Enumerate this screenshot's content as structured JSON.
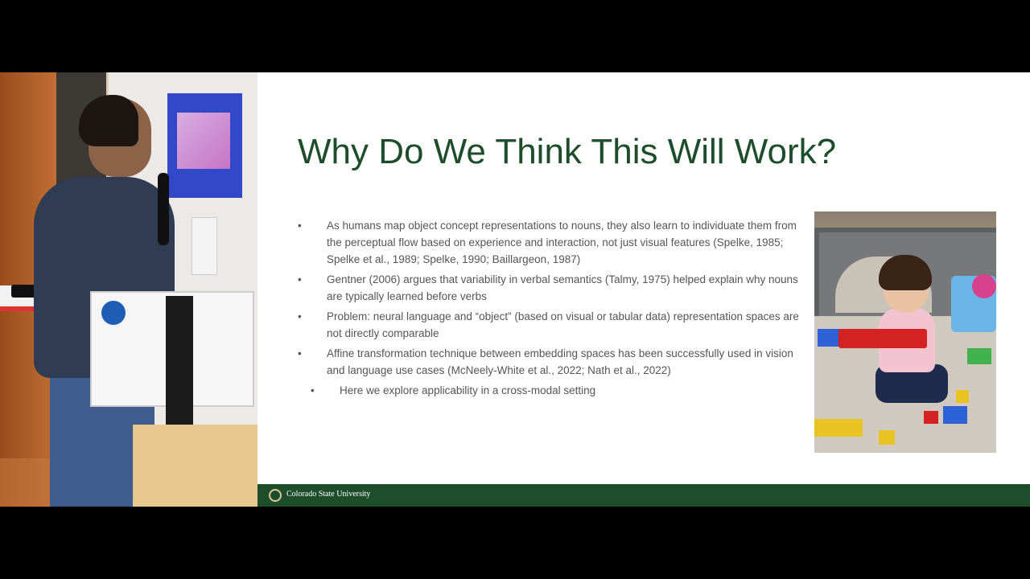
{
  "slide": {
    "title": "Why Do We Think This Will Work?",
    "bullets": [
      {
        "marker": "•",
        "text": "As humans map object concept representations to nouns, they also learn to individuate them from the perceptual flow based on experience and interaction, not just visual features (Spelke, 1985; Spelke et al., 1989; Spelke, 1990; Baillargeon, 1987)"
      },
      {
        "marker": "•",
        "text": "Gentner (2006) argues that variability in verbal semantics (Talmy, 1975) helped explain why nouns are typically learned before verbs"
      },
      {
        "marker": "•",
        "text": "Problem: neural language and “object” (based on visual or tabular data) representation spaces are not directly comparable"
      },
      {
        "marker": "•",
        "text": "Affine transformation technique between embedding spaces has been successfully used in vision and language use cases (McNeely-White et al., 2022; Nath et al., 2022)"
      }
    ],
    "sub_bullet": {
      "marker": "•",
      "text": "Here we explore applicability in a cross-modal setting"
    },
    "footer": {
      "institution": "Colorado State University"
    }
  },
  "colors": {
    "title_green": "#1e4d2b",
    "footer_green": "#1e4d2b",
    "body_text": "#555555",
    "background": "#000000"
  }
}
